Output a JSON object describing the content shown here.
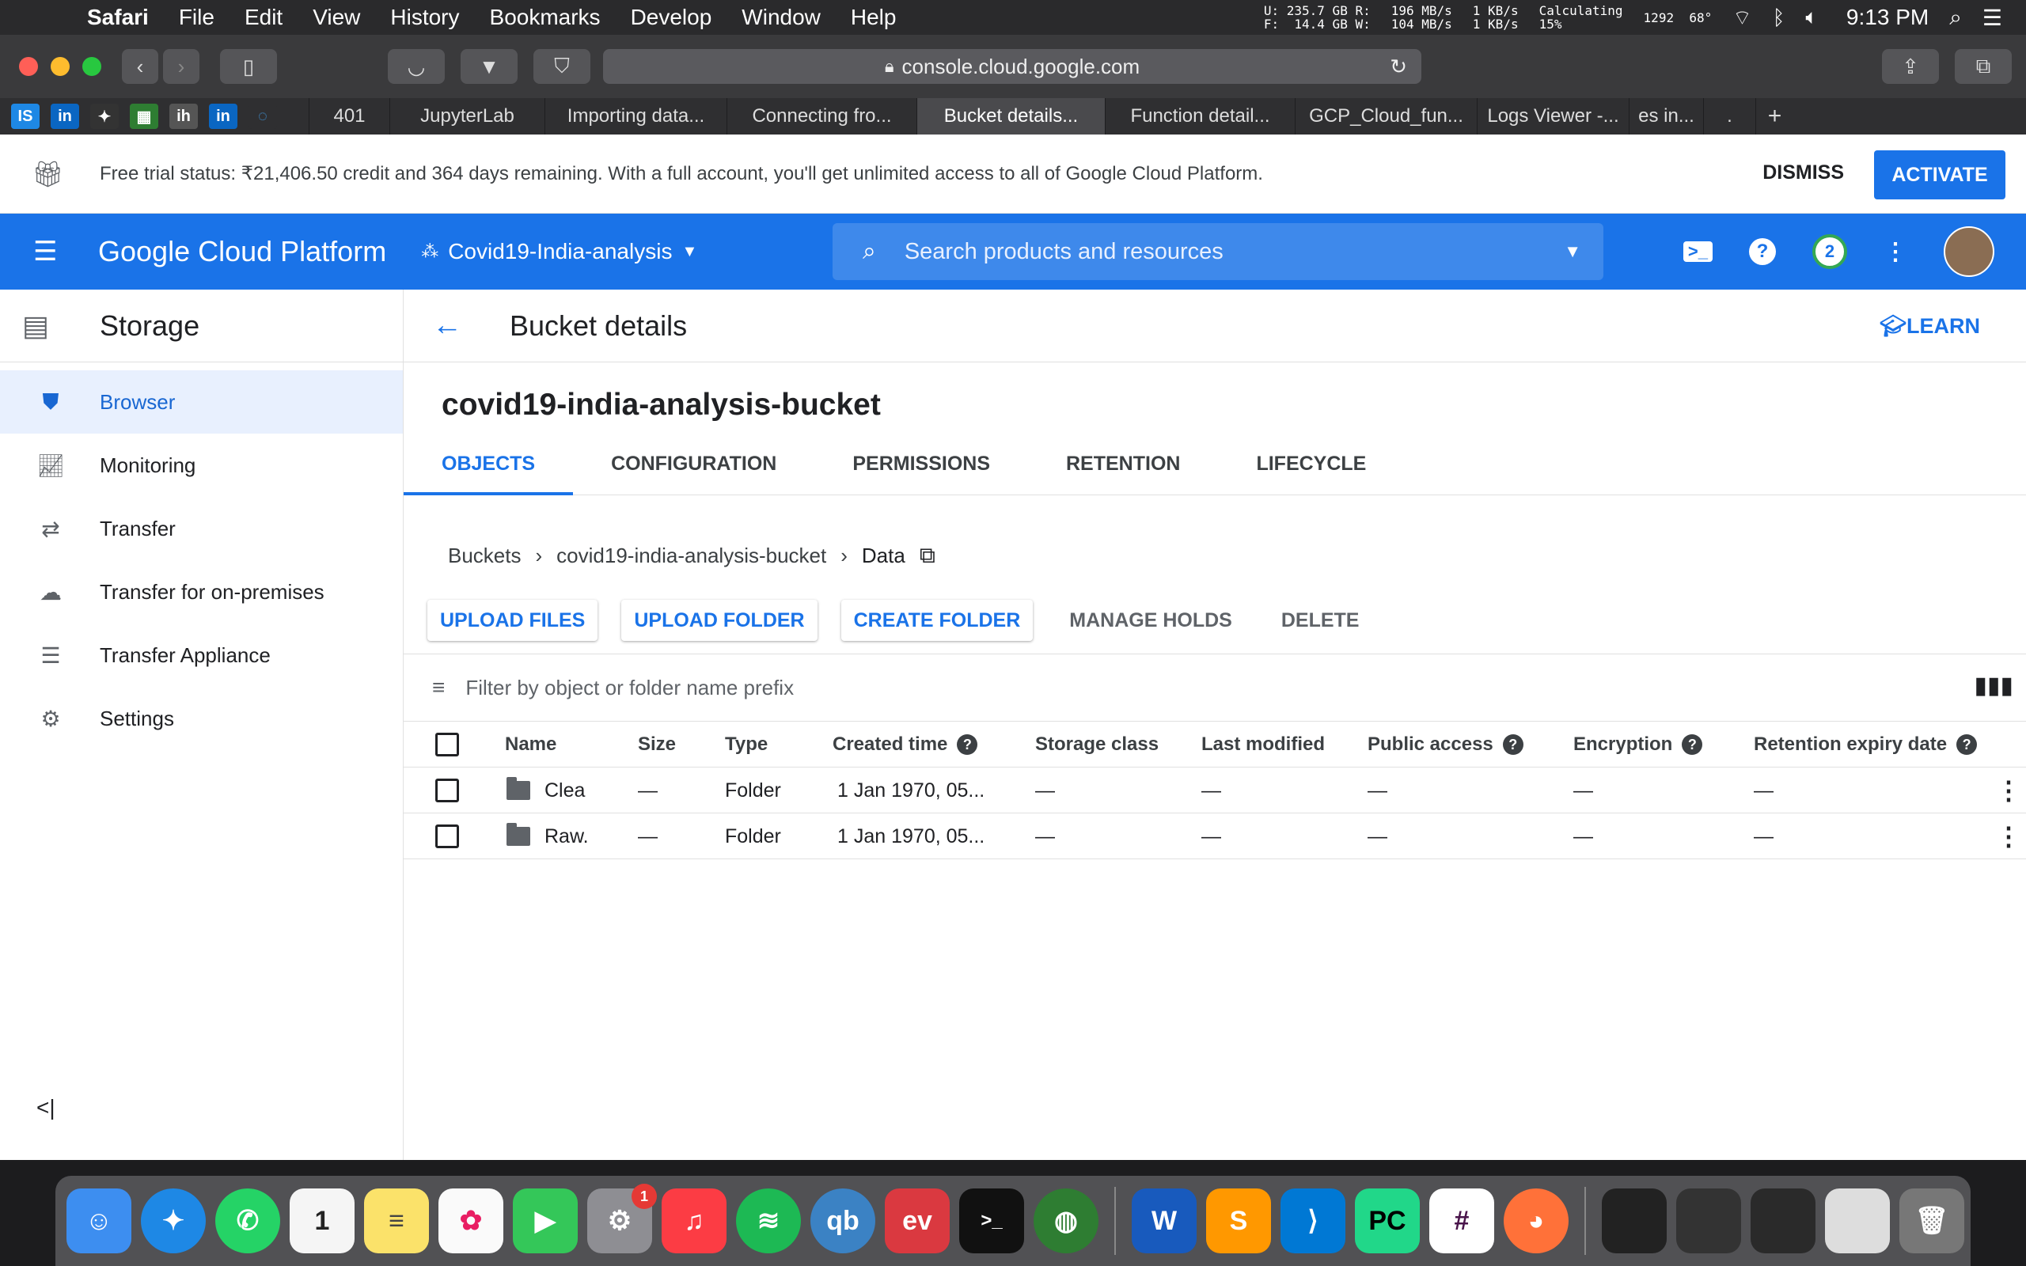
{
  "menubar": {
    "app": "Safari",
    "items": [
      "File",
      "Edit",
      "View",
      "History",
      "Bookmarks",
      "Develop",
      "Window",
      "Help"
    ],
    "disk_stat": "U: 235.7 GB R:\nF:  14.4 GB W:",
    "io_stat": "196 MB/s\n104 MB/s",
    "net_stat": "1 KB/s\n1 KB/s",
    "battery": "Calculating\n15%",
    "temps": "1292  68°",
    "clock": "9:13 PM"
  },
  "safari": {
    "url": "console.cloud.google.com",
    "tabs": [
      "401",
      "JupyterLab",
      "Importing data...",
      "Connecting fro...",
      "Bucket details...",
      "Function detail...",
      "GCP_Cloud_fun...",
      "Logs Viewer -...",
      "es in...",
      "."
    ],
    "active_tab_index": 4
  },
  "trial": {
    "message": "Free trial status: ₹21,406.50 credit and 364 days remaining. With a full account, you'll get unlimited access to all of Google Cloud Platform.",
    "dismiss": "DISMISS",
    "activate": "ACTIVATE"
  },
  "gcp": {
    "title": "Google Cloud Platform",
    "project": "Covid19-India-analysis",
    "search_placeholder": "Search products and resources",
    "notifications": "2"
  },
  "sidebar": {
    "title": "Storage",
    "items": [
      {
        "label": "Browser",
        "icon": "bucket-icon",
        "active": true
      },
      {
        "label": "Monitoring",
        "icon": "chart-icon"
      },
      {
        "label": "Transfer",
        "icon": "arrows-icon"
      },
      {
        "label": "Transfer for on-premises",
        "icon": "cloud-upload-icon"
      },
      {
        "label": "Transfer Appliance",
        "icon": "list-icon"
      },
      {
        "label": "Settings",
        "icon": "gear-icon"
      }
    ]
  },
  "main": {
    "page_title": "Bucket details",
    "learn": "LEARN",
    "bucket_name": "covid19-india-analysis-bucket",
    "tabs": [
      "OBJECTS",
      "CONFIGURATION",
      "PERMISSIONS",
      "RETENTION",
      "LIFECYCLE"
    ],
    "breadcrumb": [
      "Buckets",
      "covid19-india-analysis-bucket",
      "Data"
    ],
    "actions": {
      "upload_files": "UPLOAD FILES",
      "upload_folder": "UPLOAD FOLDER",
      "create_folder": "CREATE FOLDER",
      "manage_holds": "MANAGE HOLDS",
      "delete": "DELETE"
    },
    "filter_placeholder": "Filter by object or folder name prefix",
    "columns": [
      "Name",
      "Size",
      "Type",
      "Created time",
      "Storage class",
      "Last modified",
      "Public access",
      "Encryption",
      "Retention expiry date"
    ],
    "rows": [
      {
        "name": "Clea",
        "size": "—",
        "type": "Folder",
        "created": "1 Jan 1970, 05...",
        "storage_class": "—",
        "last_modified": "—",
        "public_access": "—",
        "encryption": "—",
        "retention": "—"
      },
      {
        "name": "Raw.",
        "size": "—",
        "type": "Folder",
        "created": "1 Jan 1970, 05...",
        "storage_class": "—",
        "last_modified": "—",
        "public_access": "—",
        "encryption": "—",
        "retention": "—"
      }
    ]
  },
  "colors": {
    "gcp_blue": "#1a73e8",
    "active_nav_bg": "#e8f0fe"
  },
  "dock": {
    "system_prefs_badge": "1"
  }
}
